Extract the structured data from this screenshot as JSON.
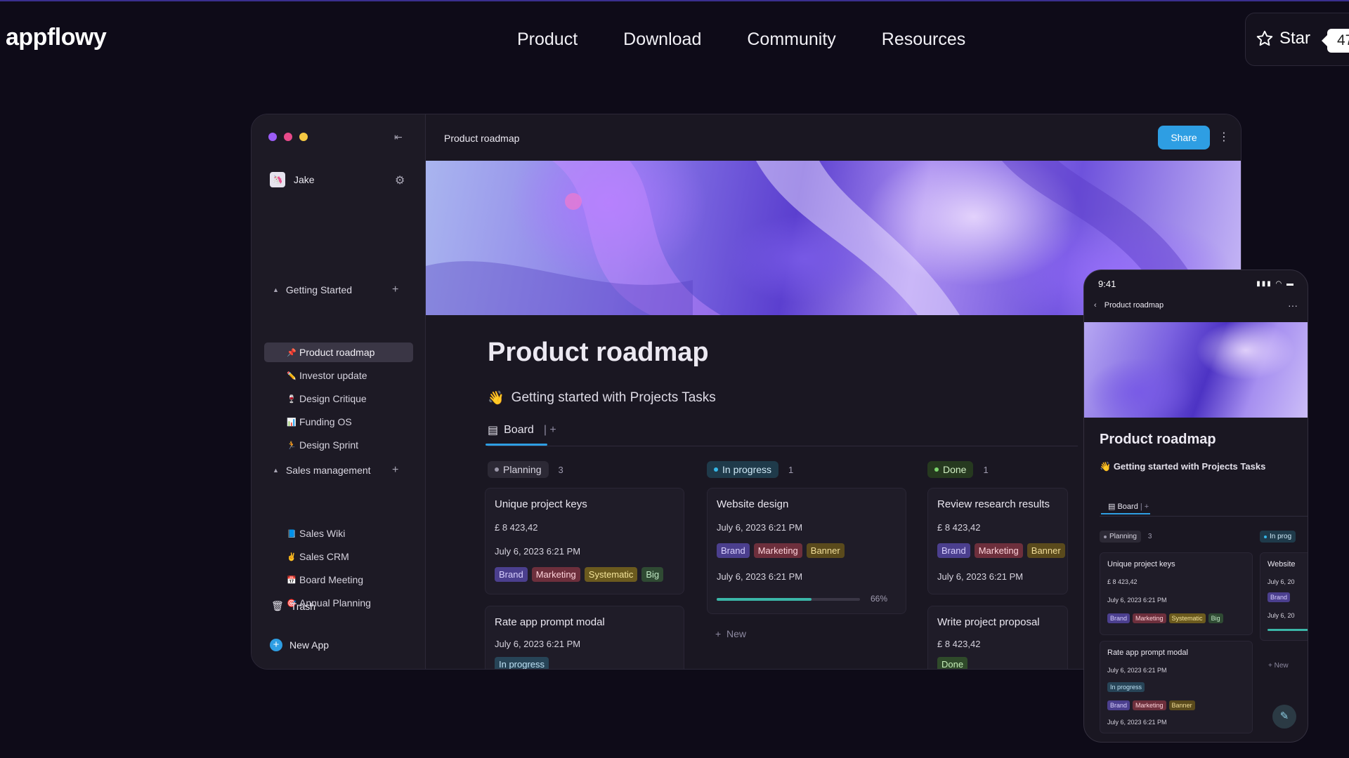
{
  "site": {
    "logo": "appflowy",
    "nav": [
      "Product",
      "Download",
      "Community",
      "Resources"
    ],
    "star_label": "Star",
    "star_count": "47"
  },
  "app": {
    "user": {
      "name": "Jake",
      "avatar": "🦄"
    },
    "sections": [
      {
        "title": "Getting Started",
        "pages": [
          {
            "emoji": "📌",
            "label": "Product roadmap",
            "active": true
          },
          {
            "emoji": "✏️",
            "label": "Investor update"
          },
          {
            "emoji": "🍷",
            "label": "Design Critique"
          },
          {
            "emoji": "📊",
            "label": "Funding OS"
          },
          {
            "emoji": "🏃",
            "label": "Design Sprint"
          }
        ]
      },
      {
        "title": "Sales management",
        "pages": [
          {
            "emoji": "📘",
            "label": "Sales Wiki"
          },
          {
            "emoji": "✌️",
            "label": "Sales CRM"
          },
          {
            "emoji": "📅",
            "label": "Board Meeting"
          },
          {
            "emoji": "🎯",
            "label": "Annual Planning"
          }
        ]
      }
    ],
    "trash_label": "Trash",
    "new_app_label": "New App",
    "header_title": "Product roadmap",
    "share_label": "Share",
    "doc_title": "Product roadmap",
    "doc_subtitle_emoji": "👋",
    "doc_subtitle": "Getting started with Projects Tasks",
    "board_tab": "Board",
    "columns": [
      {
        "label": "Planning",
        "count": "3",
        "dot": "#9a96a8"
      },
      {
        "label": "In progress",
        "count": "1",
        "dot": "#35b7e8"
      },
      {
        "label": "Done",
        "count": "1",
        "dot": "#7bd46c"
      }
    ],
    "cards": {
      "unique": {
        "title": "Unique project keys",
        "amount": "£ 8 423,42",
        "date": "July 6, 2023 6:21 PM",
        "tags": [
          "Brand",
          "Marketing",
          "Systematic",
          "Big"
        ]
      },
      "rate": {
        "title": "Rate app prompt modal",
        "date": "July 6, 2023 6:21 PM",
        "status": "In progress"
      },
      "website": {
        "title": "Website design",
        "date1": "July 6, 2023 6:21 PM",
        "tags": [
          "Brand",
          "Marketing",
          "Banner"
        ],
        "date2": "July 6, 2023 6:21 PM",
        "progress": 0.66,
        "progress_label": "66%"
      },
      "review": {
        "title": "Review research results",
        "amount": "£ 8 423,42",
        "tags": [
          "Brand",
          "Marketing",
          "Banner"
        ],
        "date": "July 6, 2023 6:21 PM"
      },
      "write": {
        "title": "Write project proposal",
        "amount": "£ 8 423,42",
        "status": "Done"
      }
    },
    "new_label": "New"
  },
  "phone": {
    "time": "9:41",
    "header_title": "Product roadmap",
    "doc_title": "Product roadmap",
    "subtitle": "Getting started with Projects Tasks",
    "board_tab": "Board",
    "planning_label": "Planning",
    "planning_count": "3",
    "inprog_label": "In prog",
    "card1": {
      "title": "Unique project keys",
      "amount": "£ 8 423,42",
      "date": "July 6, 2023 6:21 PM",
      "tags": [
        "Brand",
        "Marketing",
        "Systematic",
        "Big"
      ]
    },
    "card2": {
      "title": "Rate app prompt modal",
      "date": "July 6, 2023 6:21 PM",
      "status": "In progress",
      "tags": [
        "Brand",
        "Marketing",
        "Banner"
      ],
      "date2": "July 6, 2023 6:21 PM"
    },
    "side_title": "Website",
    "side_date": "July 6, 20",
    "side_tag": "Brand",
    "side_date2": "July 6, 20",
    "new_label": "New"
  },
  "colors": {
    "accent": "#2e9ee3",
    "bg": "#0e0b18",
    "traffic": [
      "#9b5cf6",
      "#e84a8a",
      "#f5c842"
    ]
  }
}
